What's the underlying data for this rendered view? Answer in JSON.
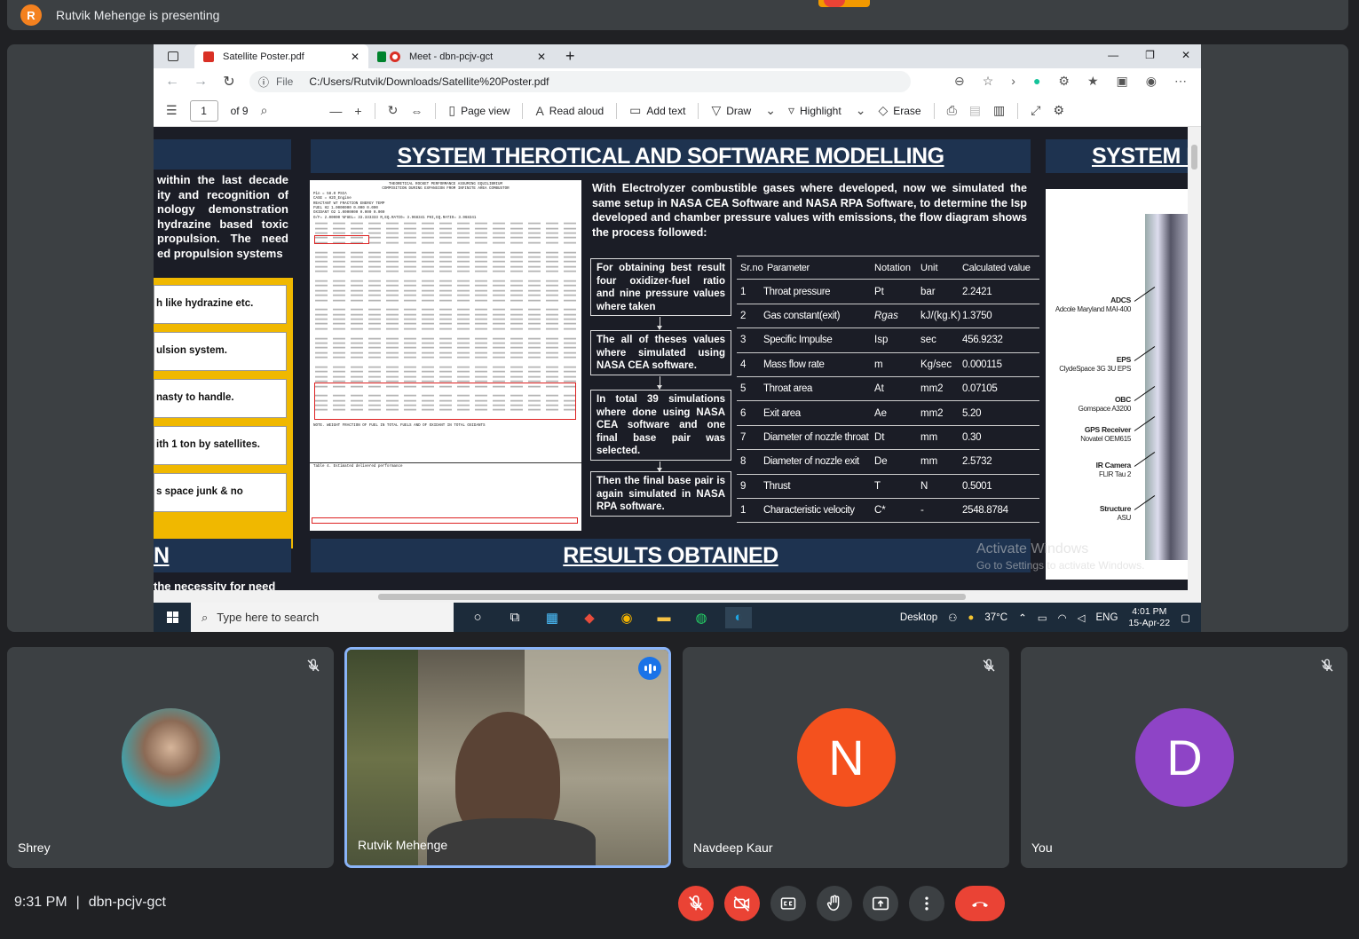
{
  "presenter": {
    "initial": "R",
    "text": "Rutvik Mehenge is presenting"
  },
  "browser": {
    "tabs": [
      {
        "label": "Satellite Poster.pdf"
      },
      {
        "label": "Meet - dbn-pcjv-gct"
      }
    ],
    "address_prefix": "File",
    "url": "C:/Users/Rutvik/Downloads/Satellite%20Poster.pdf"
  },
  "pdf_toolbar": {
    "page": "1",
    "of_pages": "of 9",
    "page_view": "Page view",
    "read_aloud": "Read aloud",
    "add_text": "Add text",
    "draw": "Draw",
    "highlight": "Highlight",
    "erase": "Erase"
  },
  "poster": {
    "main_title": "SYSTEM THEROTICAL AND SOFTWARE MODELLING",
    "right_title": "SYSTEM I",
    "results_title": "RESULTS OBTAINED",
    "left_bottom_title": "N",
    "left_text": "within the last decade ity and recognition of nology demonstration hydrazine based toxic propulsion. The need ed propulsion systems",
    "left_items": [
      "h like hydrazine etc.",
      "ulsion system.",
      "nasty to handle.",
      "ith 1 ton by satellites.",
      "s space junk & no"
    ],
    "left_bottom_fragment": "the necessity for need",
    "intro": "With Electrolyzer combustible gases where developed, now we simulated the same setup in NASA CEA Software and NASA RPA Software, to determine the Isp developed and chamber pressure values with emissions, the flow diagram shows the process followed:",
    "flow": [
      "For obtaining best result four oxidizer-fuel ratio and nine pressure values where taken",
      "The all of theses values where simulated using NASA CEA software.",
      "In total 39 simulations where done using NASA CEA software and one final base pair was selected.",
      "Then the final base pair is again simulated in NASA RPA software."
    ],
    "table": {
      "headers": [
        "Sr.no",
        "Parameter",
        "Notation",
        "Unit",
        "Calculated value"
      ],
      "rows": [
        [
          "1",
          "Throat pressure",
          "Pt",
          "bar",
          "2.2421"
        ],
        [
          "2",
          "Gas constant(exit)",
          "Rgas",
          "kJ/(kg.K)",
          "1.3750"
        ],
        [
          "3",
          "Specific Impulse",
          "Isp",
          "sec",
          "456.9232"
        ],
        [
          "4",
          "Mass flow rate",
          "m",
          "Kg/sec",
          "0.000115"
        ],
        [
          "5",
          "Throat area",
          "At",
          "mm2",
          "0.07105"
        ],
        [
          "6",
          "Exit area",
          "Ae",
          "mm2",
          "5.20"
        ],
        [
          "7",
          "Diameter of nozzle throat",
          "Dt",
          "mm",
          "0.30"
        ],
        [
          "8",
          "Diameter of nozzle exit",
          "De",
          "mm",
          "2.5732"
        ],
        [
          "9",
          "Thrust",
          "T",
          "N",
          "0.5001"
        ],
        [
          "1",
          "Characteristic velocity",
          "C*",
          "-",
          "2548.8784"
        ]
      ]
    },
    "satellite_labels": [
      {
        "name": "ADCS",
        "sub": "Adcole Maryland MAI-400"
      },
      {
        "name": "EPS",
        "sub": "ClydeSpace 3G 3U EPS"
      },
      {
        "name": "OBC",
        "sub": "Gomspace A3200"
      },
      {
        "name": "GPS Receiver",
        "sub": "Novatel OEM615"
      },
      {
        "name": "IR Camera",
        "sub": "FLIR Tau 2"
      },
      {
        "name": "Structure",
        "sub": "ASU"
      }
    ],
    "sim_header": [
      "THEORETICAL ROCKET PERFORMANCE ASSUMING EQUILIBRIUM",
      "COMPOSITION DURING EXPANSION FROM INFINITE AREA COMBUSTOR",
      "Pin = 58.0 PSIA",
      "CASE = H2O_Engine",
      "REACTANT   WT FRACTION   ENERGY   TEMP",
      "FUEL  H2  1.0000000  0.000  0.000",
      "OXIDANT  O2  1.0000000  0.000  0.000",
      "O/F= 2.00000  %FUEL= 33.333333  R,EQ.RATIO= 3.968341  PHI,EQ.RATIO= 3.968341"
    ],
    "sim_note": "NOTE. WEIGHT FRACTION OF FUEL IN TOTAL FUELS AND OF OXIDANT IN TOTAL OXIDANTS",
    "sim_table_title": "Table 4. Estimated delivered performance",
    "watermark_title": "Activate Windows",
    "watermark_sub": "Go to Settings to activate Windows."
  },
  "taskbar": {
    "search_placeholder": "Type here to search",
    "desktop": "Desktop",
    "weather": "37°C",
    "language": "ENG",
    "time": "4:01 PM",
    "date": "15-Apr-22"
  },
  "participants": [
    {
      "name": "Shrey",
      "initial": "",
      "color": "#4a6a7a"
    },
    {
      "name": "Rutvik Mehenge",
      "initial": "",
      "color": ""
    },
    {
      "name": "Navdeep Kaur",
      "initial": "N",
      "color": "#f4511e"
    },
    {
      "name": "You",
      "initial": "D",
      "color": "#8e44c6"
    }
  ],
  "footer": {
    "time": "9:31 PM",
    "separator": "|",
    "meeting_code": "dbn-pcjv-gct"
  }
}
